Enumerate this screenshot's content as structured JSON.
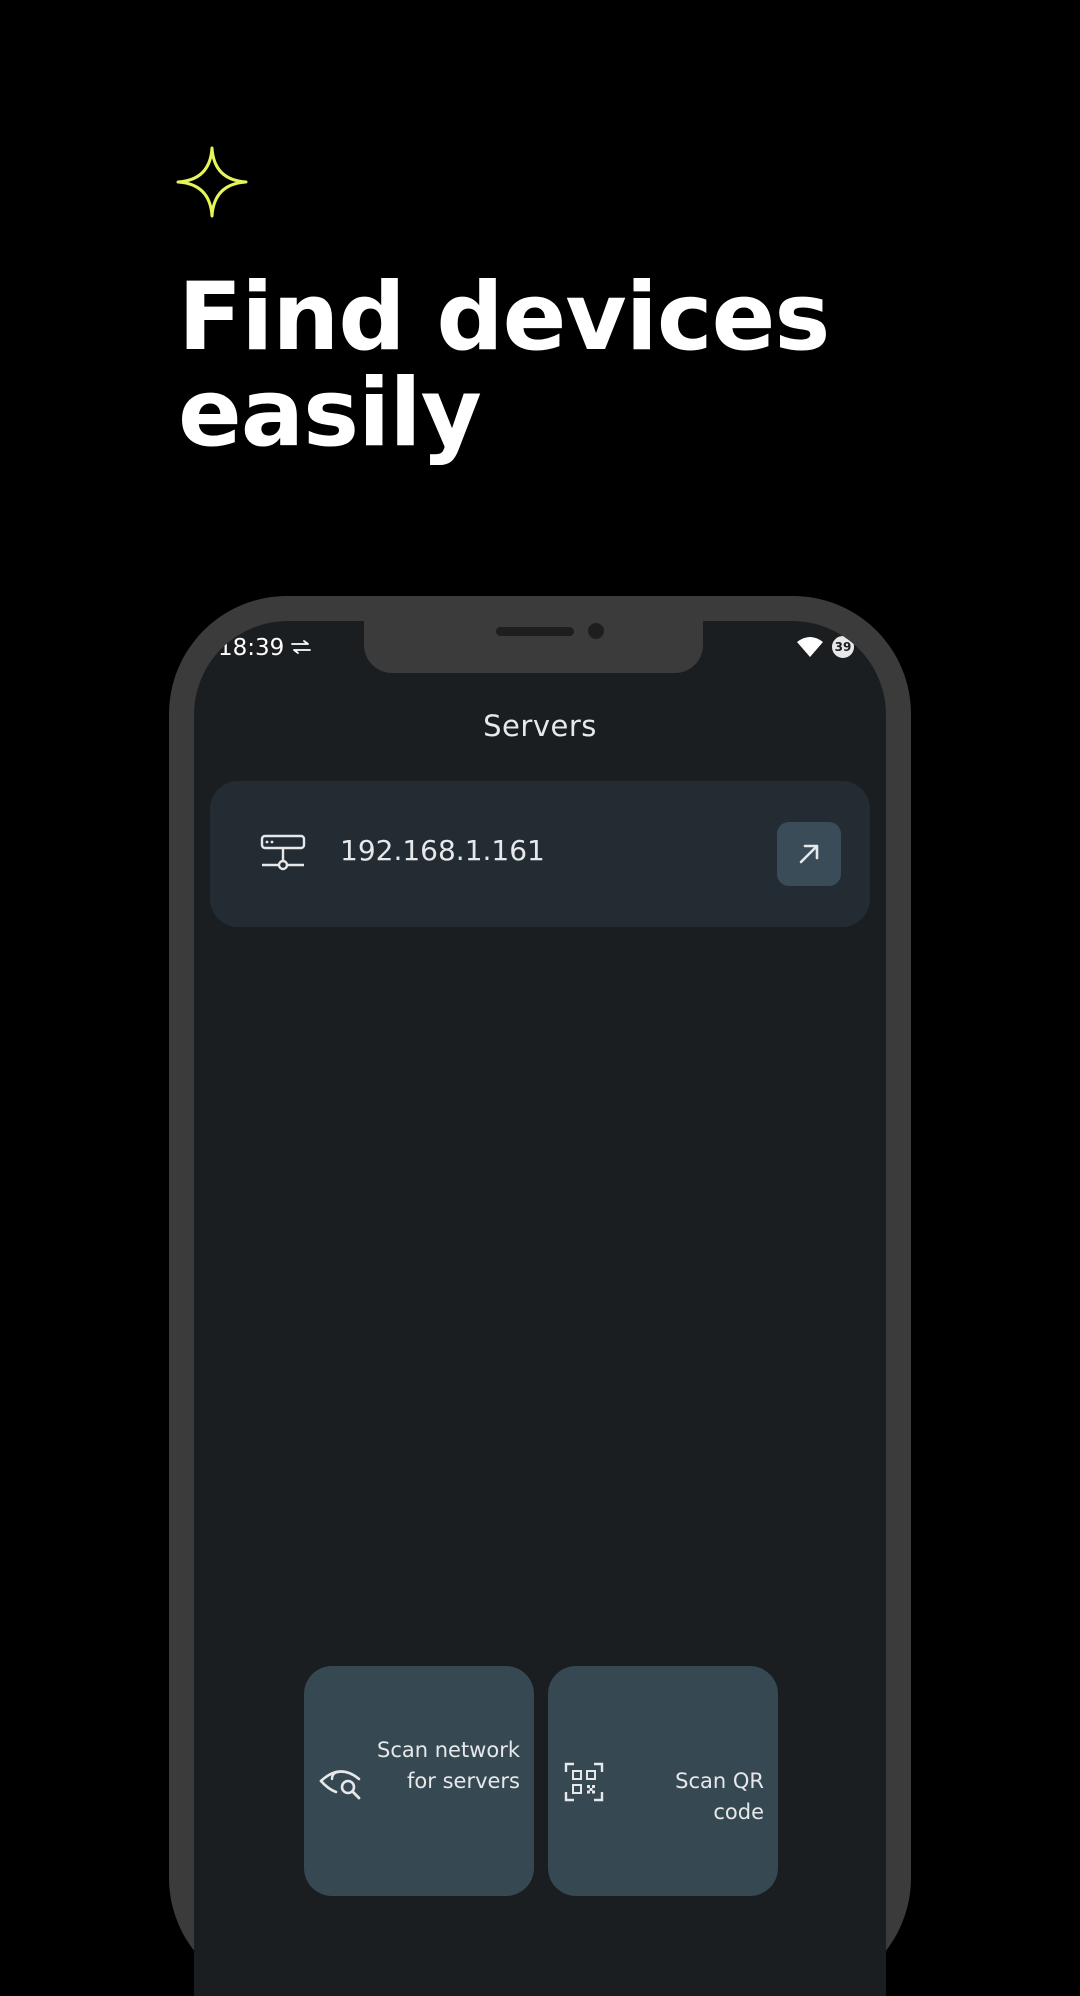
{
  "headline": {
    "line1": "Find devices",
    "line2": "easily"
  },
  "colors": {
    "background": "#000000",
    "accent_sparkle": "#e6f55a",
    "phone_frame": "#3b3b3b",
    "screen_background": "#1a1e21",
    "card_background": "#242c33",
    "action_background": "#364852"
  },
  "status_bar": {
    "time": "18:39",
    "battery": "39",
    "icons": [
      "swap-arrows-icon",
      "wifi-icon",
      "battery-icon"
    ]
  },
  "app": {
    "title": "Servers",
    "servers": [
      {
        "address": "192.168.1.161",
        "icon": "server-icon",
        "action_icon": "arrow-up-right-icon"
      }
    ],
    "actions": [
      {
        "label": "Scan network for servers",
        "icon": "eye-search-icon"
      },
      {
        "label": "Scan QR code",
        "icon": "qr-code-icon"
      }
    ]
  }
}
